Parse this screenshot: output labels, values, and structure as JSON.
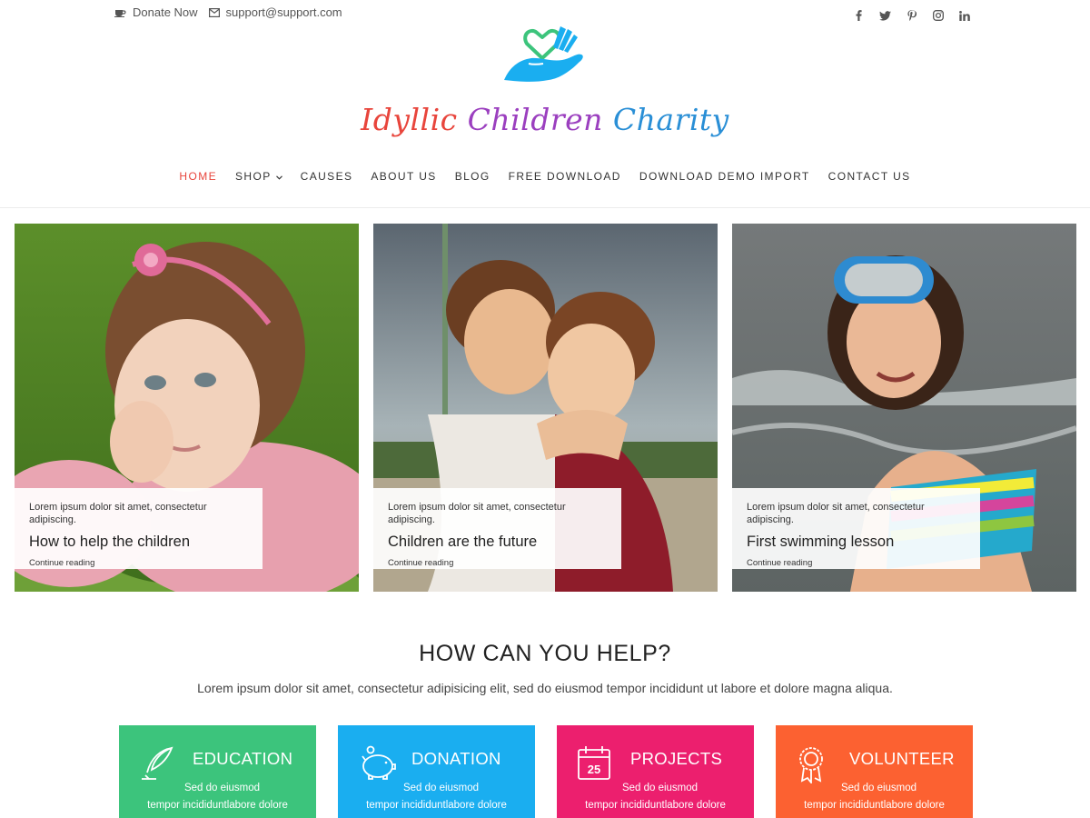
{
  "topbar": {
    "donate_label": "Donate Now",
    "email_label": "support@support.com",
    "social": [
      "facebook-icon",
      "twitter-icon",
      "pinterest-icon",
      "instagram-icon",
      "linkedin-icon"
    ]
  },
  "logo": {
    "title_word1": "Idyllic",
    "title_word2": "Children",
    "title_word3": "Charity"
  },
  "nav": {
    "items": [
      {
        "label": "HOME"
      },
      {
        "label": "SHOP"
      },
      {
        "label": "CAUSES"
      },
      {
        "label": "ABOUT US"
      },
      {
        "label": "BLOG"
      },
      {
        "label": "FREE DOWNLOAD"
      },
      {
        "label": "DOWNLOAD DEMO IMPORT"
      },
      {
        "label": "CONTACT US"
      }
    ]
  },
  "slides": [
    {
      "excerpt": "Lorem ipsum dolor sit amet, consectetur adipiscing.",
      "title": "How to help the children",
      "link": "Continue reading"
    },
    {
      "excerpt": "Lorem ipsum dolor sit amet, consectetur adipiscing.",
      "title": "Children are the future",
      "link": "Continue reading"
    },
    {
      "excerpt": "Lorem ipsum dolor sit amet, consectetur adipiscing.",
      "title": "First swimming lesson",
      "link": "Continue reading"
    }
  ],
  "help": {
    "title": "HOW CAN YOU HELP?",
    "subtitle": "Lorem ipsum dolor sit amet, consectetur adipisicing elit, sed do eiusmod tempor incididunt ut labore et dolore magna aliqua.",
    "boxes": [
      {
        "title": "EDUCATION",
        "line1": "Sed do eiusmod",
        "line2": "tempor incididuntlabore dolore",
        "color": "#3cc47c",
        "icon": "feather-icon"
      },
      {
        "title": "DONATION",
        "line1": "Sed do eiusmod",
        "line2": "tempor incididuntlabore dolore",
        "color": "#1aaef0",
        "icon": "piggy-bank-icon"
      },
      {
        "title": "PROJECTS",
        "line1": "Sed do eiusmod",
        "line2": "tempor incididuntlabore dolore",
        "color": "#ec1f6e",
        "icon": "calendar-icon"
      },
      {
        "title": "VOLUNTEER",
        "line1": "Sed do eiusmod",
        "line2": "tempor incididuntlabore dolore",
        "color": "#fc6131",
        "icon": "award-icon"
      }
    ]
  },
  "calendar_day": "25",
  "colors": {
    "accent": "#e8453c",
    "logo_green": "#3cc47c",
    "logo_blue": "#1aaef0"
  }
}
